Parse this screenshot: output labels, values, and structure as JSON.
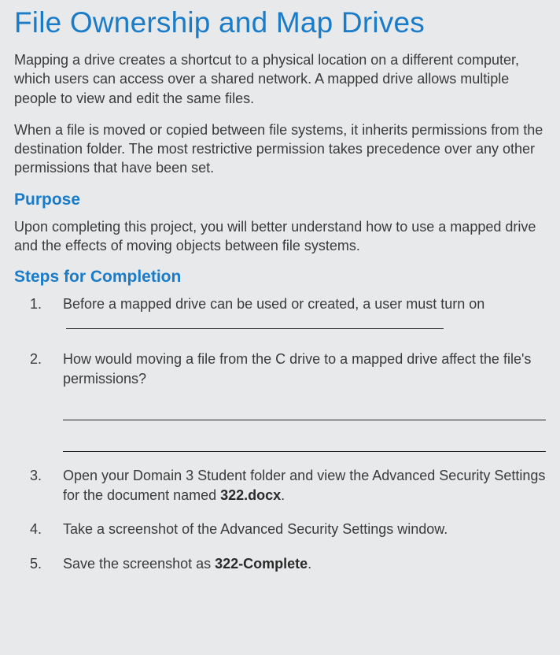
{
  "title": "File Ownership and Map Drives",
  "intro1": "Mapping a drive creates a shortcut to a physical location on a different computer, which users can access over a shared network. A mapped drive allows multiple people to view and edit the same files.",
  "intro2": "When a file is moved or copied between file systems, it inherits permissions from the destination folder. The most restrictive permission takes precedence over any other permissions that have been set.",
  "purpose_heading": "Purpose",
  "purpose_text": "Upon completing this project, you will better understand how to use a mapped drive and the effects of moving objects between file systems.",
  "steps_heading": "Steps for Completion",
  "steps": {
    "s1a": "Before a mapped drive can be used or created, a user must turn on ",
    "s2": "How would moving a file from the C drive to a mapped drive affect the file's permissions?",
    "s3a": "Open your Domain 3 Student folder and view the Advanced Security Settings for the document named ",
    "s3b": "322.docx",
    "s3c": ".",
    "s4": "Take a screenshot of the Advanced Security Settings window.",
    "s5a": "Save the screenshot as ",
    "s5b": "322-Complete",
    "s5c": "."
  }
}
